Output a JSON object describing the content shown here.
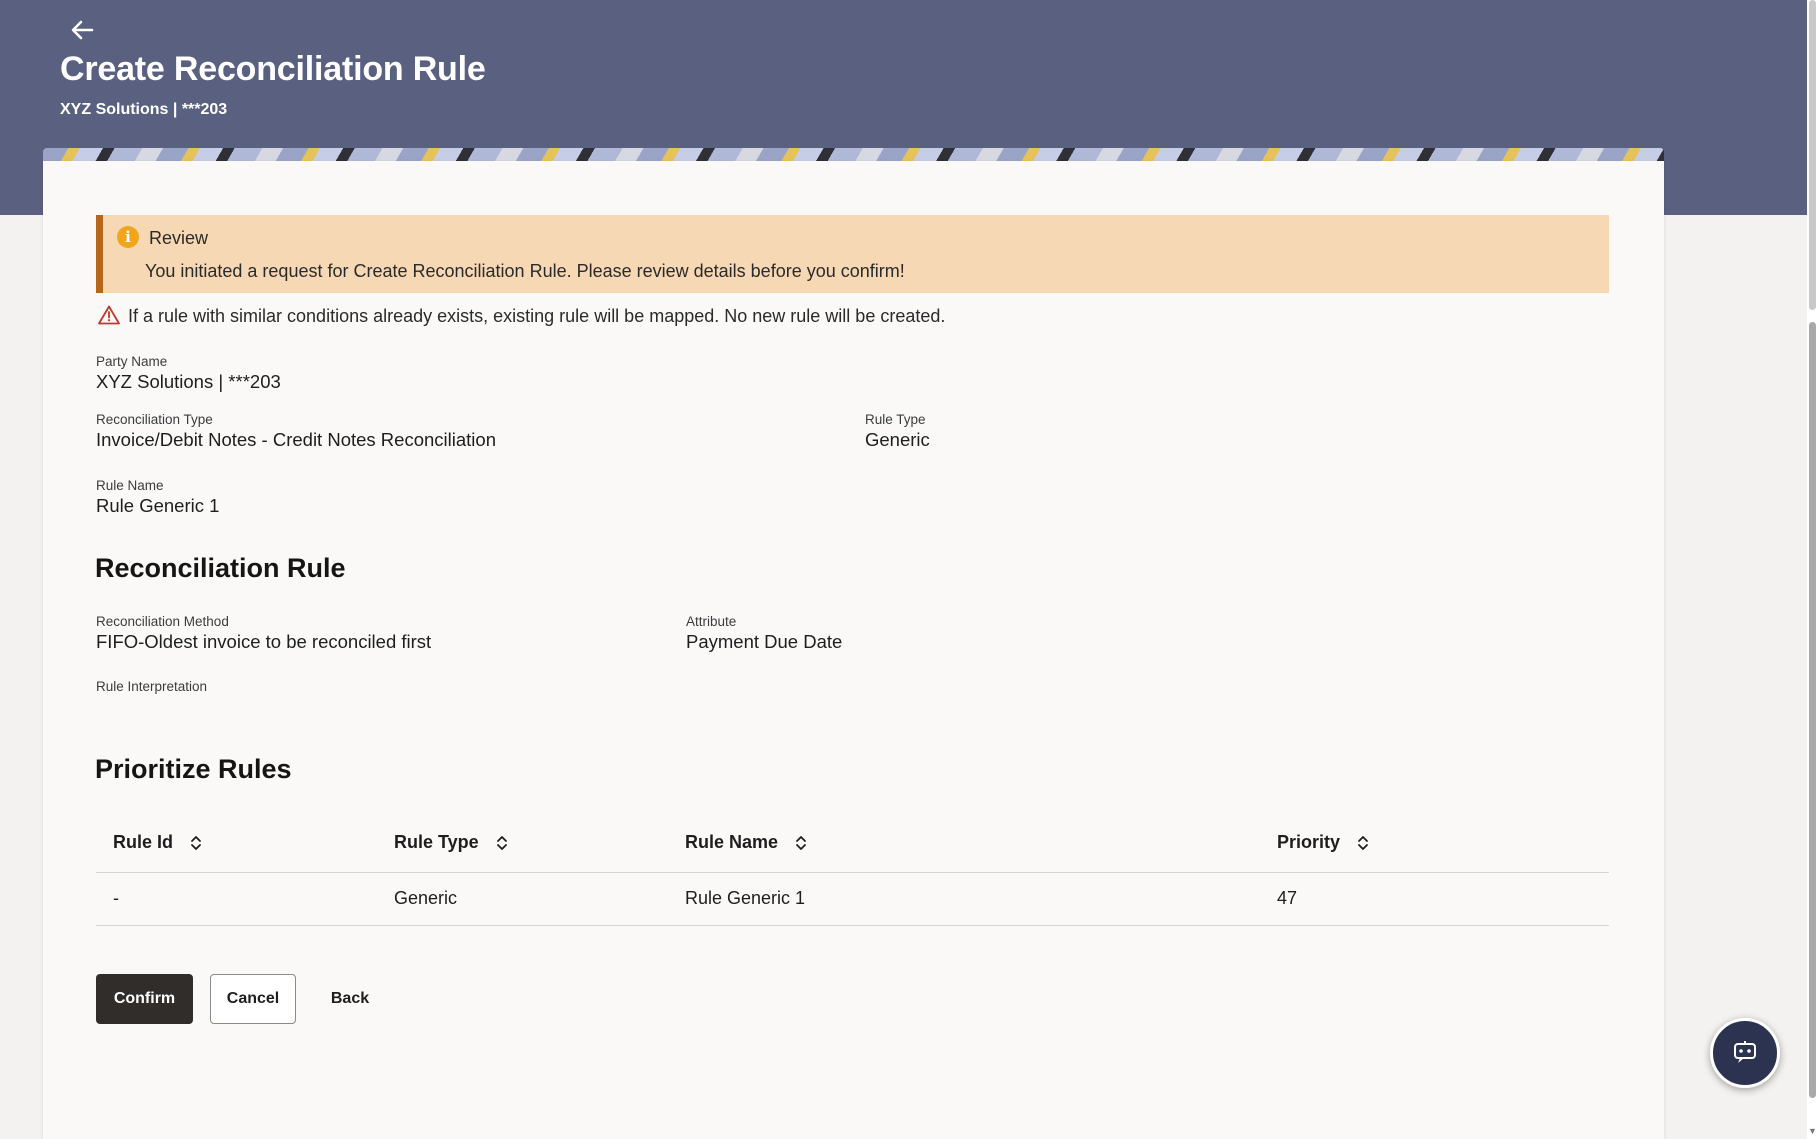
{
  "header": {
    "title": "Create Reconciliation Rule",
    "subtitle": "XYZ Solutions | ***203",
    "back_icon": "arrow-left-icon",
    "background_color": "#5a6080"
  },
  "review": {
    "icon": "info-icon",
    "icon_text": "i",
    "title": "Review",
    "message": "You initiated a request for Create Reconciliation Rule. Please review details before you confirm!",
    "background_color": "#f7d8b5",
    "accent_color": "#b4661c"
  },
  "warning": {
    "icon": "warning-triangle-icon",
    "text": "If a rule with similar conditions already exists, existing rule will be mapped. No new rule will be created."
  },
  "details": {
    "party_name": {
      "label": "Party Name",
      "value": "XYZ Solutions | ***203"
    },
    "reconciliation_type": {
      "label": "Reconciliation Type",
      "value": "Invoice/Debit Notes - Credit Notes Reconciliation"
    },
    "rule_type": {
      "label": "Rule Type",
      "value": "Generic"
    },
    "rule_name": {
      "label": "Rule Name",
      "value": "Rule Generic 1"
    }
  },
  "reconciliation_rule": {
    "heading": "Reconciliation Rule",
    "method": {
      "label": "Reconciliation Method",
      "value": "FIFO-Oldest invoice to be reconciled first"
    },
    "attribute": {
      "label": "Attribute",
      "value": "Payment Due Date"
    },
    "interpretation": {
      "label": "Rule Interpretation",
      "value": ""
    }
  },
  "prioritize": {
    "heading": "Prioritize Rules",
    "columns": [
      "Rule Id",
      "Rule Type",
      "Rule Name",
      "Priority"
    ],
    "sort_icon": "sort-updown-icon",
    "rows": [
      [
        "-",
        "Generic",
        "Rule Generic 1",
        "47"
      ]
    ]
  },
  "actions": {
    "confirm_label": "Confirm",
    "cancel_label": "Cancel",
    "back_label": "Back",
    "confirm_color": "#312d2a"
  },
  "chat_fab": {
    "icon": "chatbot-icon"
  }
}
